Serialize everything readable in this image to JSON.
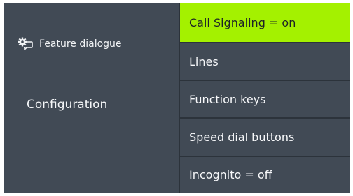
{
  "left_panel": {
    "feature_label": "Feature dialogue",
    "feature_icon": "gear-speech-icon",
    "section_label": "Configuration"
  },
  "menu": {
    "items": [
      {
        "label": "Call Signaling = on",
        "selected": true
      },
      {
        "label": "Lines",
        "selected": false
      },
      {
        "label": "Function keys",
        "selected": false
      },
      {
        "label": "Speed dial buttons",
        "selected": false
      },
      {
        "label": "Incognito = off",
        "selected": false
      }
    ]
  },
  "colors": {
    "panel_background": "#414a55",
    "selected_highlight": "#a4f100",
    "text": "#f7f8fa"
  }
}
